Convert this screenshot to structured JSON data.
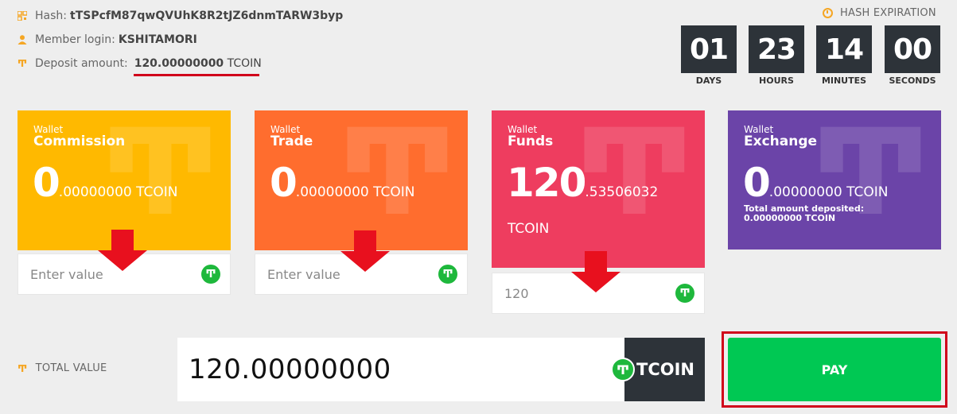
{
  "info": {
    "hash_label": "Hash:",
    "hash_value": "tTSPcfM87qwQVUhK8R2tJZ6dnmTARW3byp",
    "member_label": "Member login:",
    "member_value": "KSHITAMORI",
    "deposit_label": "Deposit amount:",
    "deposit_value": "120.00000000",
    "deposit_unit": "TCOIN"
  },
  "expiration": {
    "label": "HASH EXPIRATION",
    "days": "01",
    "days_label": "DAYS",
    "hours": "23",
    "hours_label": "HOURS",
    "minutes": "14",
    "minutes_label": "MINUTES",
    "seconds": "00",
    "seconds_label": "SECONDS"
  },
  "wallets": [
    {
      "small": "Wallet",
      "name": "Commission",
      "int": "0",
      "dec": ".00000000 TCOIN",
      "color": "#ffb900",
      "input_placeholder": "Enter value"
    },
    {
      "small": "Wallet",
      "name": "Trade",
      "int": "0",
      "dec": ".00000000 TCOIN",
      "color": "#ff6d2e",
      "input_placeholder": "Enter value"
    },
    {
      "small": "Wallet",
      "name": "Funds",
      "int": "120",
      "dec": ".53506032",
      "unit": "TCOIN",
      "color": "#ee3d5f",
      "input_value": "120"
    },
    {
      "small": "Wallet",
      "name": "Exchange",
      "int": "0",
      "dec": ".00000000 TCOIN",
      "note1": "Total amount deposited:",
      "note2": "0.00000000 TCOIN",
      "color": "#6b44a8"
    }
  ],
  "total": {
    "label": "TOTAL VALUE",
    "value": "120.00000000",
    "unit": "TCOIN"
  },
  "pay_label": "PAY",
  "colors": {
    "annotation_red": "#d0021b",
    "accent_orange": "#f5a623",
    "pay_green": "#00c853",
    "dark": "#2d3339"
  }
}
